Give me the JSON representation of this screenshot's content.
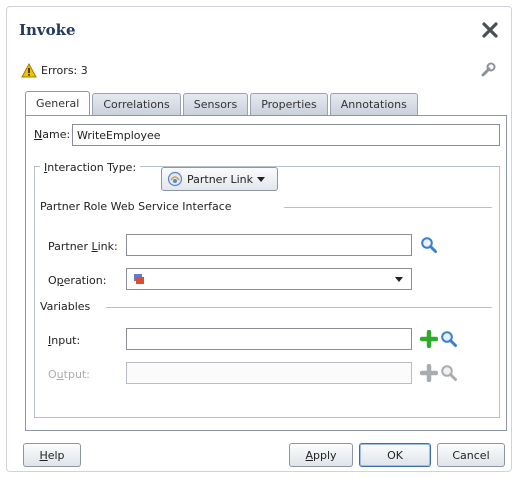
{
  "dialog": {
    "title": "Invoke",
    "errors_label": "Errors: 3"
  },
  "tabs": [
    {
      "label": "General",
      "active": true
    },
    {
      "label": "Correlations",
      "active": false
    },
    {
      "label": "Sensors",
      "active": false
    },
    {
      "label": "Properties",
      "active": false
    },
    {
      "label": "Annotations",
      "active": false
    }
  ],
  "general": {
    "name_label_mnemonic": "N",
    "name_label_rest": "ame:",
    "name_value": "WriteEmployee",
    "interaction_label_pre": " ",
    "interaction_label_mnemonic": "I",
    "interaction_label_rest": "nteraction Type:",
    "interaction_value": "Partner Link",
    "partner_role_section": "Partner Role Web Service Interface",
    "partner_link_label_pre": "Partner ",
    "partner_link_label_mnemonic": "L",
    "partner_link_label_rest": "ink:",
    "partner_link_value": "",
    "operation_label_pre": "O",
    "operation_label_mnemonic": "p",
    "operation_label_rest": "eration:",
    "operation_value": "",
    "variables_section": "Variables",
    "input_label_mnemonic": "I",
    "input_label_rest": "nput:",
    "input_value": "",
    "output_label_pre": "O",
    "output_label_mnemonic": "u",
    "output_label_rest": "tput:",
    "output_value": ""
  },
  "buttons": {
    "help_mnemonic": "H",
    "help_rest": "elp",
    "apply_mnemonic": "A",
    "apply_rest": "pply",
    "ok": "OK",
    "cancel": "Cancel"
  },
  "icons": {
    "close": "close-icon",
    "warning": "warning-icon",
    "wrench": "wrench-icon",
    "interaction": "partner-link-icon",
    "dropdown": "chevron-down-icon",
    "search": "search-icon",
    "add": "add-icon",
    "operation": "operation-icon"
  },
  "colors": {
    "title": "#243a5e",
    "warning": "#f2c200",
    "add_green": "#2eaa2e",
    "search_blue": "#3c7fd1"
  }
}
